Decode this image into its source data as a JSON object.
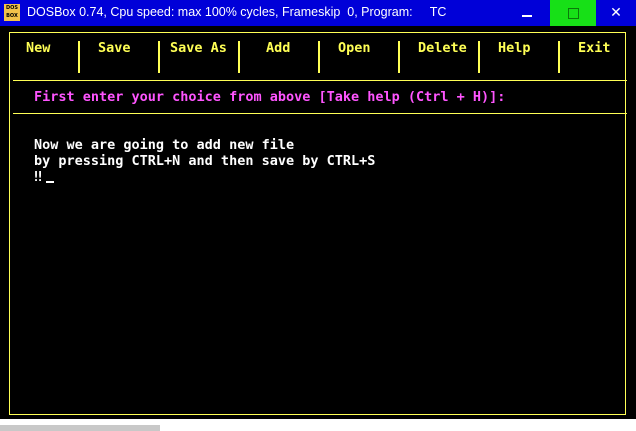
{
  "window": {
    "title": "DOSBox 0.74, Cpu speed: max 100% cycles, Frameskip  0, Program:     TC",
    "icon_label": "DOS BOX",
    "controls": {
      "minimize_icon": "minimize-icon",
      "maximize_icon": "maximize-icon",
      "close_icon": "close-icon",
      "close_glyph": "✕"
    },
    "maximize_color": "#17e017",
    "titlebar_color": "#0000d8"
  },
  "menu": {
    "items": [
      {
        "label": "New"
      },
      {
        "label": "Save"
      },
      {
        "label": "Save As"
      },
      {
        "label": "Add"
      },
      {
        "label": "Open"
      },
      {
        "label": "Delete"
      },
      {
        "label": "Help"
      },
      {
        "label": "Exit"
      }
    ],
    "color": "#ffff55"
  },
  "prompt": {
    "text": "First enter your choice from above [Take help (Ctrl + H)]:",
    "color": "#ff55ff"
  },
  "output": {
    "lines": [
      "Now we are going to add new file",
      "by pressing CTRL+N and then save by CTRL+S",
      "‼"
    ]
  }
}
